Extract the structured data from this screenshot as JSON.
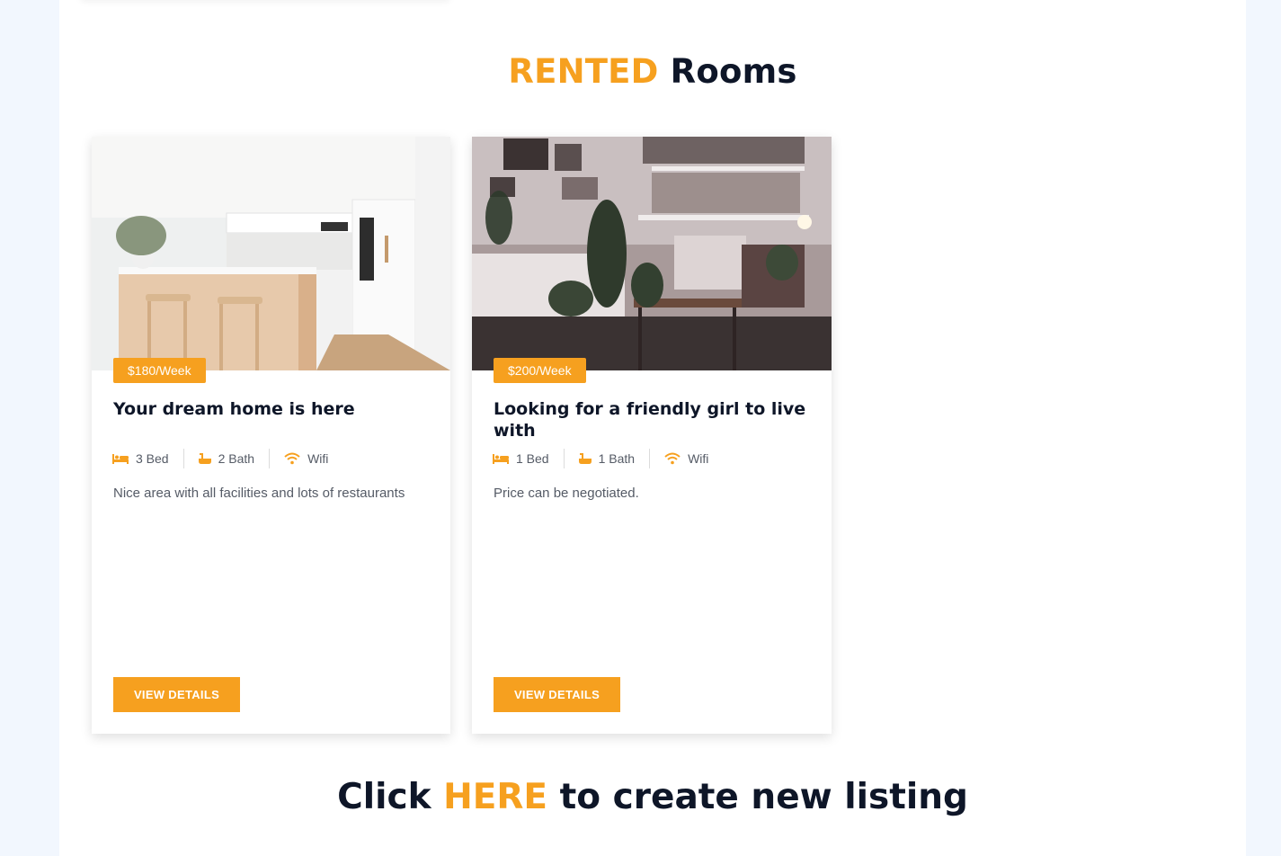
{
  "section": {
    "title_accent": "RENTED",
    "title_rest": "Rooms"
  },
  "colors": {
    "accent": "#f6a01f",
    "heading": "#0e1628",
    "body_text": "#555b66",
    "page_background": "#f2f7fe"
  },
  "cards": [
    {
      "image_icon": "kitchen-photo",
      "price": "$180/Week",
      "title": "Your dream home is here",
      "amenities": [
        {
          "icon": "bed-icon",
          "label": "3 Bed"
        },
        {
          "icon": "bath-icon",
          "label": "2 Bath"
        },
        {
          "icon": "wifi-icon",
          "label": "Wifi"
        }
      ],
      "description": "Nice area with all facilities and lots of restaurants",
      "button_label": "VIEW DETAILS"
    },
    {
      "image_icon": "bedroom-photo",
      "price": "$200/Week",
      "title": "Looking for a friendly girl to live with",
      "amenities": [
        {
          "icon": "bed-icon",
          "label": "1 Bed"
        },
        {
          "icon": "bath-icon",
          "label": "1 Bath"
        },
        {
          "icon": "wifi-icon",
          "label": "Wifi"
        }
      ],
      "description": "Price can be negotiated.",
      "button_label": "VIEW DETAILS"
    }
  ],
  "footer": {
    "prefix": "Click",
    "link": "HERE",
    "suffix": "to create new listing"
  }
}
